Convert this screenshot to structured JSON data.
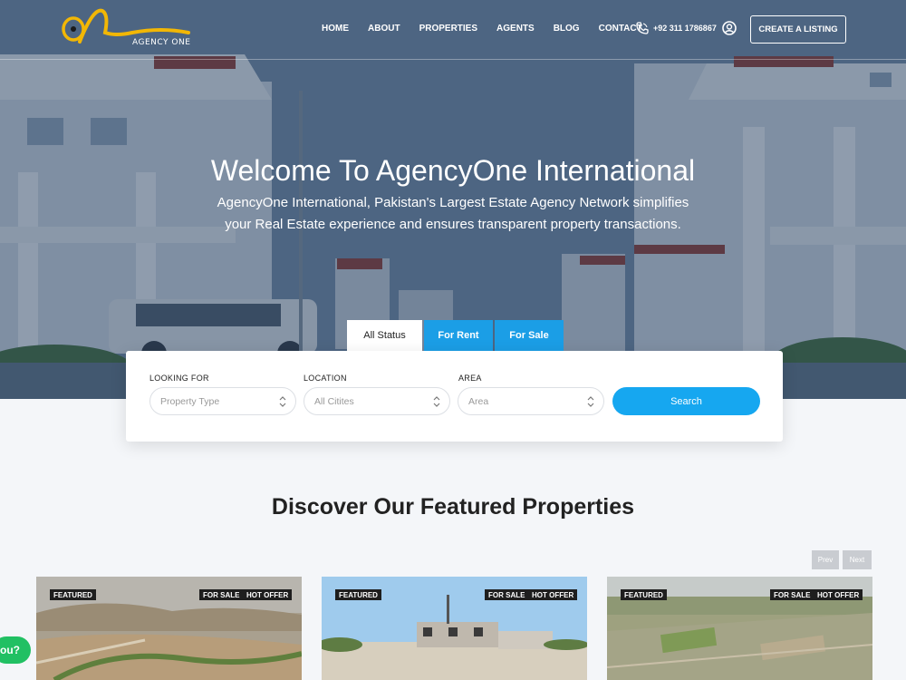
{
  "nav": {
    "logo_text": "AGENCY ONE",
    "links": [
      "HOME",
      "ABOUT",
      "PROPERTIES",
      "AGENTS",
      "BLOG",
      "CONTACT"
    ],
    "phone": "+92 311 1786867",
    "create_listing": "CREATE A LISTING"
  },
  "hero": {
    "title": "Welcome To AgencyOne International",
    "subtitle": "AgencyOne International, Pakistan's Largest Estate Agency Network simplifies your Real Estate experience and ensures transparent property transactions."
  },
  "search": {
    "tabs": [
      "All Status",
      "For Rent",
      "For Sale"
    ],
    "active_tab": "All Status",
    "fields": [
      {
        "label": "LOOKING FOR",
        "placeholder": "Property Type"
      },
      {
        "label": "LOCATION",
        "placeholder": "All Citites"
      },
      {
        "label": "AREA",
        "placeholder": "Area"
      }
    ],
    "button": "Search"
  },
  "featured": {
    "title": "Discover Our Featured Properties",
    "prev": "Prev",
    "next": "Next",
    "cards": [
      {
        "featured": "FEATURED",
        "status": "FOR SALE",
        "offer": "HOT OFFER"
      },
      {
        "featured": "FEATURED",
        "status": "FOR SALE",
        "offer": "HOT OFFER"
      },
      {
        "featured": "FEATURED",
        "status": "FOR SALE",
        "offer": "HOT OFFER"
      }
    ]
  },
  "chat": {
    "label": "ou?"
  },
  "colors": {
    "accent": "#16a7f0",
    "logo_yellow": "#f2b705",
    "chat_green": "#21c063",
    "badge_dark": "#1e1e1e"
  },
  "icons": [
    "phone-icon",
    "user-icon",
    "select-arrows-icon",
    "logo-mark"
  ]
}
